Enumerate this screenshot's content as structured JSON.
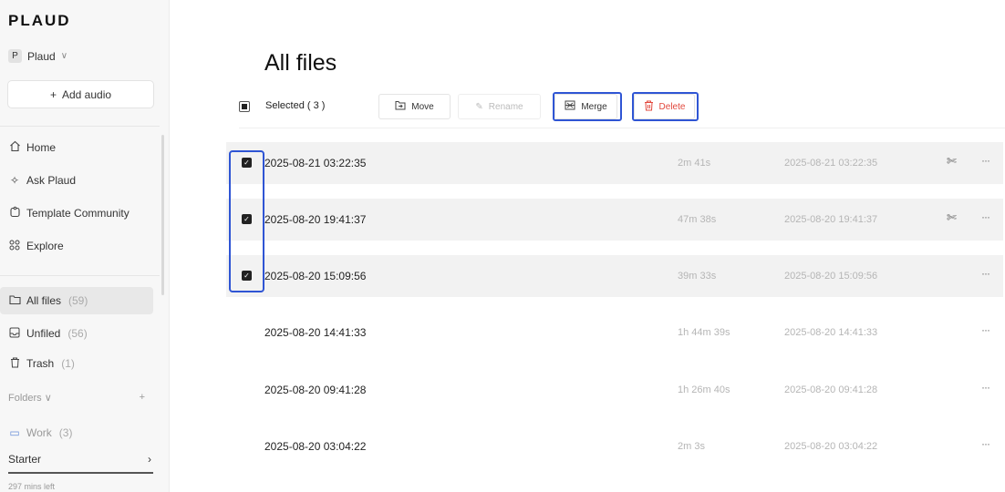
{
  "brand": "PLAUD",
  "workspace": {
    "avatar_letter": "P",
    "name": "Plaud"
  },
  "add_audio_label": "Add audio",
  "nav": [
    {
      "label": "Home",
      "icon": "home-icon"
    },
    {
      "label": "Ask Plaud",
      "icon": "sparkle-icon"
    },
    {
      "label": "Template Community",
      "icon": "template-icon"
    },
    {
      "label": "Explore",
      "icon": "grid-icon"
    }
  ],
  "libraries": [
    {
      "label": "All files",
      "count": "(59)",
      "icon": "folder-icon",
      "active": true
    },
    {
      "label": "Unfiled",
      "count": "(56)",
      "icon": "inbox-icon"
    },
    {
      "label": "Trash",
      "count": "(1)",
      "icon": "trash-icon"
    }
  ],
  "folders": {
    "label": "Folders",
    "items": [
      {
        "label": "Work",
        "count": "(3)"
      }
    ]
  },
  "plan": {
    "name": "Starter",
    "minutes_left": "297 mins left"
  },
  "main": {
    "title": "All files",
    "selected_label": "Selected ( 3 )",
    "actions": {
      "move": "Move",
      "rename": "Rename",
      "merge": "Merge",
      "delete": "Delete"
    }
  },
  "files": [
    {
      "name": "2025-08-21 03:22:35",
      "duration": "2m 41s",
      "date": "2025-08-21 03:22:35",
      "selected": true,
      "ai": true
    },
    {
      "name": "2025-08-20 19:41:37",
      "duration": "47m 38s",
      "date": "2025-08-20 19:41:37",
      "selected": true,
      "ai": true
    },
    {
      "name": "2025-08-20 15:09:56",
      "duration": "39m 33s",
      "date": "2025-08-20 15:09:56",
      "selected": true,
      "ai": false
    },
    {
      "name": "2025-08-20 14:41:33",
      "duration": "1h 44m 39s",
      "date": "2025-08-20 14:41:33",
      "selected": false,
      "ai": false
    },
    {
      "name": "2025-08-20 09:41:28",
      "duration": "1h 26m 40s",
      "date": "2025-08-20 09:41:28",
      "selected": false,
      "ai": false
    },
    {
      "name": "2025-08-20 03:04:22",
      "duration": "2m 3s",
      "date": "2025-08-20 03:04:22",
      "selected": false,
      "ai": false
    }
  ],
  "colors": {
    "highlight": "#2f55d4",
    "danger": "#e2483d",
    "selected_row": "#f2f2f2"
  }
}
